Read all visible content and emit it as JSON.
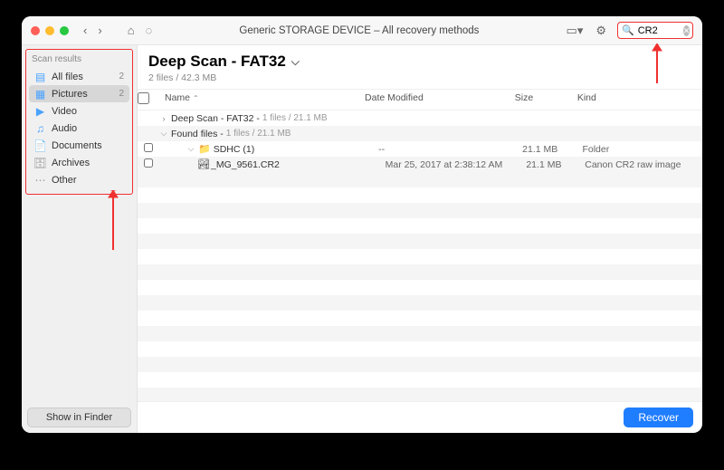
{
  "titlebar": {
    "title": "Generic STORAGE DEVICE – All recovery methods",
    "search_value": "CR2"
  },
  "sidebar": {
    "section": "Scan results",
    "items": [
      {
        "icon": "▤",
        "label": "All files",
        "count": "2",
        "gray": false
      },
      {
        "icon": "▦",
        "label": "Pictures",
        "count": "2",
        "selected": true,
        "gray": false
      },
      {
        "icon": "▶",
        "label": "Video",
        "gray": false
      },
      {
        "icon": "♫",
        "label": "Audio",
        "gray": false
      },
      {
        "icon": "📄",
        "label": "Documents",
        "gray": true
      },
      {
        "icon": "🗄",
        "label": "Archives",
        "gray": true
      },
      {
        "icon": "⋯",
        "label": "Other",
        "gray": true
      }
    ],
    "finder_button": "Show in Finder"
  },
  "main": {
    "title": "Deep Scan - FAT32",
    "subtitle": "2 files / 42.3 MB",
    "columns": {
      "name": "Name",
      "date": "Date Modified",
      "size": "Size",
      "kind": "Kind"
    },
    "groups": [
      {
        "disclosure": "›",
        "label": "Deep Scan - FAT32 -",
        "meta": "1 files / 21.1 MB"
      },
      {
        "disclosure": "⌵",
        "label": "Found files -",
        "meta": "1 files / 21.1 MB"
      }
    ],
    "rows": [
      {
        "indent": 2,
        "disclosure": "⌵",
        "icon": "📁",
        "name": "SDHC (1)",
        "date": "--",
        "size": "21.1 MB",
        "kind": "Folder"
      },
      {
        "indent": 3,
        "icon": "🏞",
        "name": "_MG_9561.CR2",
        "date": "Mar 25, 2017 at 2:38:12 AM",
        "size": "21.1 MB",
        "kind": "Canon CR2 raw image"
      }
    ],
    "recover": "Recover"
  }
}
